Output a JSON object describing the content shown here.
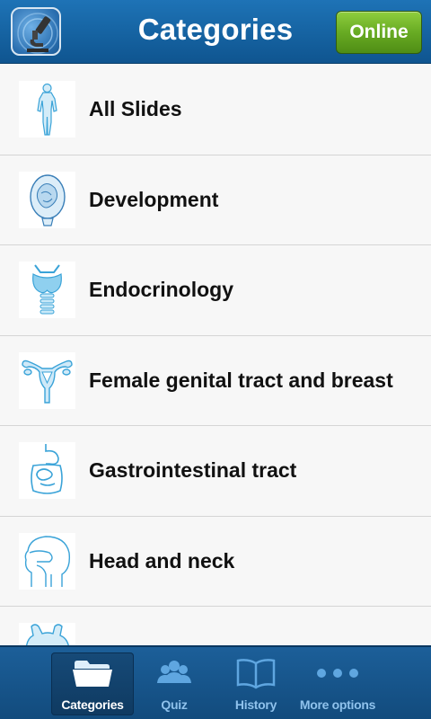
{
  "header": {
    "title": "Categories",
    "online_label": "Online",
    "logo_icon": "microscope-icon"
  },
  "categories": [
    {
      "label": "All Slides",
      "icon": "human-body-icon"
    },
    {
      "label": "Development",
      "icon": "fetus-icon"
    },
    {
      "label": "Endocrinology",
      "icon": "thyroid-icon"
    },
    {
      "label": "Female genital tract and breast",
      "icon": "uterus-icon"
    },
    {
      "label": "Gastrointestinal tract",
      "icon": "intestines-icon"
    },
    {
      "label": "Head and neck",
      "icon": "head-profile-icon"
    },
    {
      "label": "",
      "icon": "heart-icon"
    }
  ],
  "tabs": [
    {
      "label": "Categories",
      "icon": "folder-icon",
      "active": true
    },
    {
      "label": "Quiz",
      "icon": "people-icon",
      "active": false
    },
    {
      "label": "History",
      "icon": "book-icon",
      "active": false
    },
    {
      "label": "More options",
      "icon": "more-dots-icon",
      "active": false
    }
  ],
  "colors": {
    "header_blue": "#1664a3",
    "online_green": "#68ab23",
    "tab_inactive": "#8fc2ec",
    "illustration_blue": "#3aa3d8"
  }
}
